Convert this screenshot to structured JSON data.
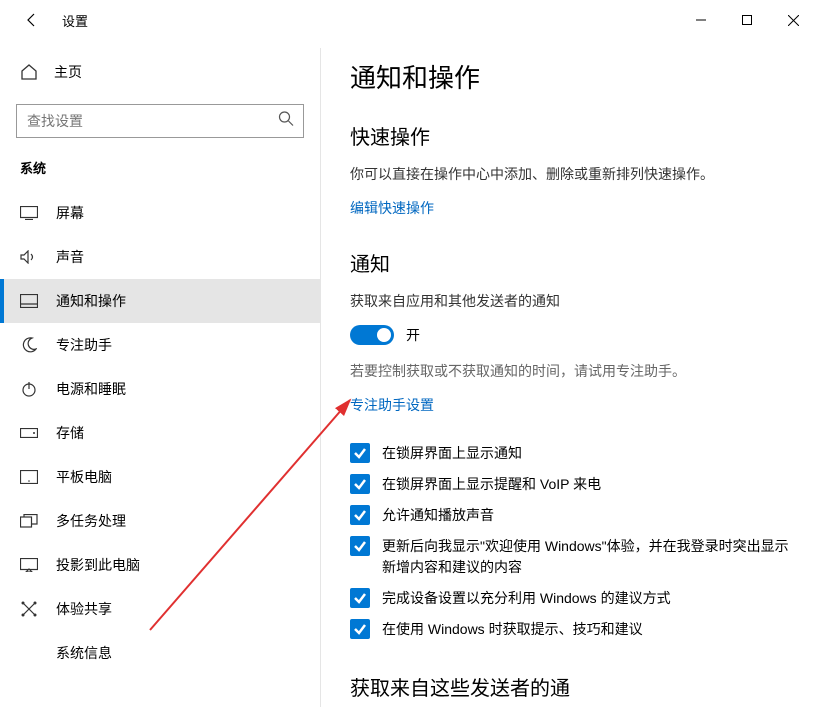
{
  "titlebar": {
    "title": "设置"
  },
  "sidebar": {
    "home": "主页",
    "search_placeholder": "查找设置",
    "section": "系统",
    "items": [
      {
        "label": "屏幕"
      },
      {
        "label": "声音"
      },
      {
        "label": "通知和操作"
      },
      {
        "label": "专注助手"
      },
      {
        "label": "电源和睡眠"
      },
      {
        "label": "存储"
      },
      {
        "label": "平板电脑"
      },
      {
        "label": "多任务处理"
      },
      {
        "label": "投影到此电脑"
      },
      {
        "label": "体验共享"
      },
      {
        "label": "系统信息"
      }
    ]
  },
  "main": {
    "page_title": "通知和操作",
    "quick": {
      "title": "快速操作",
      "desc": "你可以直接在操作中心中添加、删除或重新排列快速操作。",
      "link": "编辑快速操作"
    },
    "notif": {
      "title": "通知",
      "line1": "获取来自应用和其他发送者的通知",
      "toggle_state": "开",
      "hint": "若要控制获取或不获取通知的时间，请试用专注助手。",
      "focus_link": "专注助手设置",
      "cb": [
        "在锁屏界面上显示通知",
        "在锁屏界面上显示提醒和 VoIP 来电",
        "允许通知播放声音",
        "更新后向我显示\"欢迎使用 Windows\"体验，并在我登录时突出显示新增内容和建议的内容",
        "完成设备设置以充分利用 Windows 的建议方式",
        "在使用 Windows 时获取提示、技巧和建议"
      ]
    },
    "senders_title": "获取来自这些发送者的通"
  }
}
